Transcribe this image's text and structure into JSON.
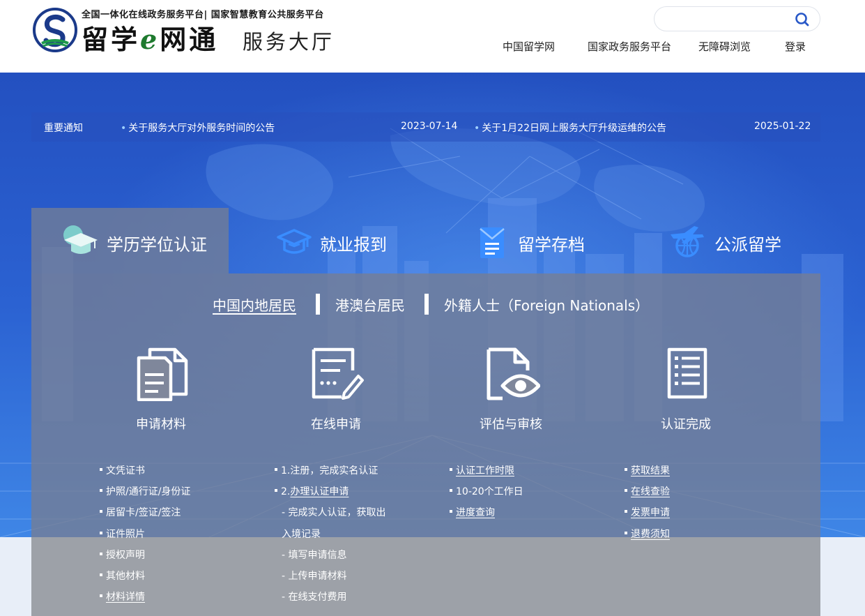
{
  "header": {
    "tagline": "全国一体化在线政务服务平台| 国家智慧教育公共服务平台",
    "logo_main_1": "留学",
    "logo_main_e": "e",
    "logo_main_2": "网通",
    "logo_sub": "服务大厅",
    "search_placeholder": "",
    "nav": [
      {
        "label": "中国留学网"
      },
      {
        "label": "国家政务服务平台"
      },
      {
        "label": "无障碍浏览"
      },
      {
        "label": "登录"
      }
    ]
  },
  "notice": {
    "title": "重要通知",
    "items": [
      {
        "text": "关于服务大厅对外服务时间的公告",
        "date": "2023-07-14"
      },
      {
        "text": "关于1月22日网上服务大厅升级运维的公告",
        "date": "2025-01-22"
      }
    ]
  },
  "service_tabs": [
    {
      "label": "学历学位认证",
      "icon": "graduation-cap-icon",
      "active": true
    },
    {
      "label": "就业报到",
      "icon": "graduation-cap-outline-icon",
      "active": false
    },
    {
      "label": "留学存档",
      "icon": "archive-document-icon",
      "active": false
    },
    {
      "label": "公派留学",
      "icon": "airplane-globe-icon",
      "active": false
    }
  ],
  "sub_tabs": [
    {
      "label": "中国内地居民",
      "active": true
    },
    {
      "label": "港澳台居民",
      "active": false
    },
    {
      "label": "外籍人士（Foreign Nationals）",
      "active": false
    }
  ],
  "steps": [
    {
      "label": "申请材料",
      "icon": "documents-icon",
      "items": [
        {
          "text": "文凭证书",
          "link": false
        },
        {
          "text": "护照/通行证/身份证",
          "link": false
        },
        {
          "text": "居留卡/签证/签注",
          "link": false
        },
        {
          "text": "证件照片",
          "link": false
        },
        {
          "text": "授权声明",
          "link": false
        },
        {
          "text": "其他材料",
          "link": false
        },
        {
          "text": "材料详情",
          "link": true
        }
      ]
    },
    {
      "label": "在线申请",
      "icon": "edit-form-icon",
      "items": [
        {
          "text": "1.注册，完成实名认证",
          "link": false,
          "bullet": true
        },
        {
          "text": "2.办理认证申请",
          "link": true,
          "bullet": true,
          "prefix": "2.",
          "linked": "办理认证申请"
        },
        {
          "text": "- 完成实人认证，获取出",
          "link": false,
          "bullet": false
        },
        {
          "text": "入境记录",
          "link": false,
          "bullet": false
        },
        {
          "text": "- 填写申请信息",
          "link": false,
          "bullet": false
        },
        {
          "text": "- 上传申请材料",
          "link": false,
          "bullet": false
        },
        {
          "text": "- 在线支付费用",
          "link": false,
          "bullet": false
        }
      ]
    },
    {
      "label": "评估与审核",
      "icon": "document-eye-icon",
      "items": [
        {
          "text": "认证工作时限",
          "link": true
        },
        {
          "text": "10-20个工作日",
          "link": false
        },
        {
          "text": "进度查询",
          "link": true
        }
      ]
    },
    {
      "label": "认证完成",
      "icon": "document-list-icon",
      "items": [
        {
          "text": "获取结果",
          "link": true
        },
        {
          "text": "在线查验",
          "link": true
        },
        {
          "text": "发票申请",
          "link": true
        },
        {
          "text": "退费须知",
          "link": true
        }
      ]
    }
  ],
  "colors": {
    "hero_blue": "#2b58c6",
    "panel_gray": "#767e94",
    "tab_icon_blue": "#3a8dff",
    "tab_icon_teal": "#7fd6cf"
  }
}
